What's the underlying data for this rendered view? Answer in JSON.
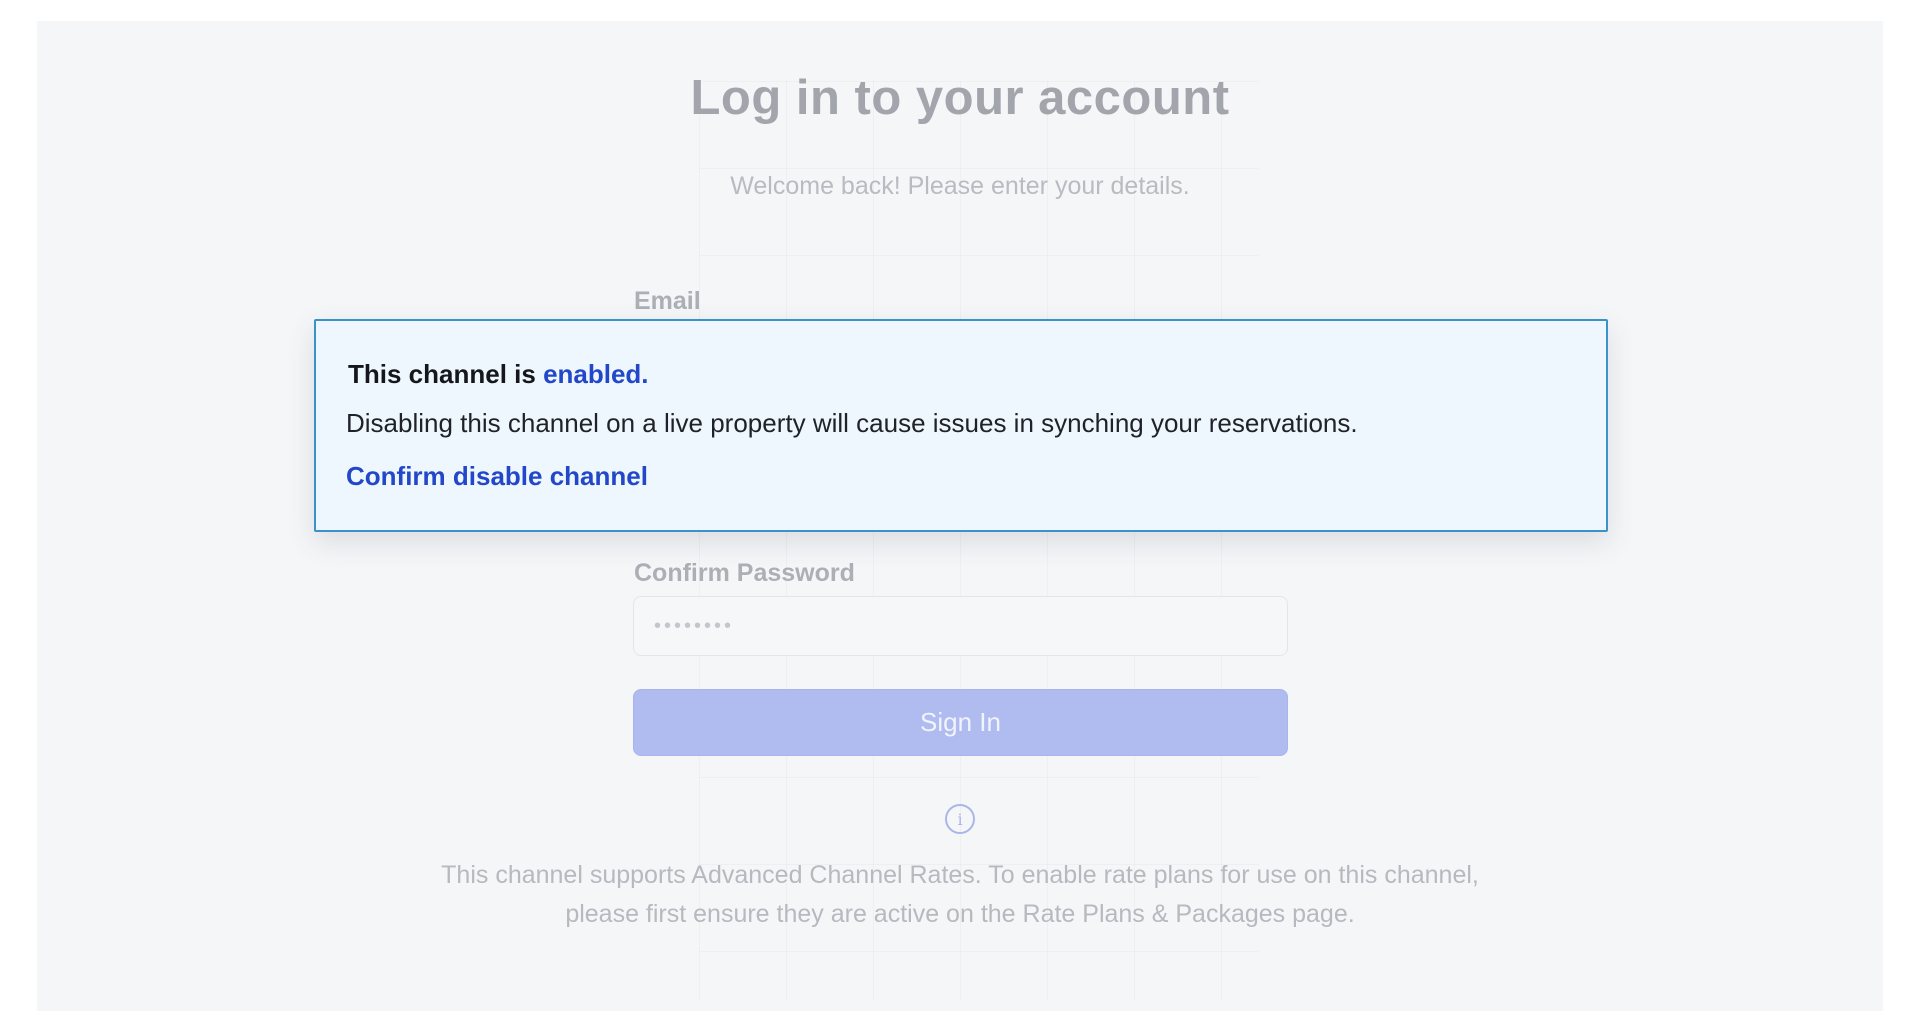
{
  "login": {
    "title": "Log in to your account",
    "subtitle": "Welcome back! Please enter your details.",
    "email_label": "Email",
    "confirm_password_label": "Confirm Password",
    "confirm_password_value": "••••••••",
    "sign_in_label": "Sign In"
  },
  "info": {
    "icon": "info-icon",
    "icon_glyph": "i",
    "text": "This channel supports Advanced Channel Rates. To enable rate plans for use on this channel, please first ensure they are active on the Rate Plans & Packages page."
  },
  "alert": {
    "title_prefix": "This channel is ",
    "status": "enabled.",
    "message": "Disabling this channel on a live property will cause issues in synching your reservations.",
    "action_label": "Confirm disable channel"
  },
  "colors": {
    "accent": "#2347c9",
    "alert_border": "#3b92c9",
    "alert_background": "#eef7fd",
    "sign_in_button": "#b0bcf0"
  }
}
